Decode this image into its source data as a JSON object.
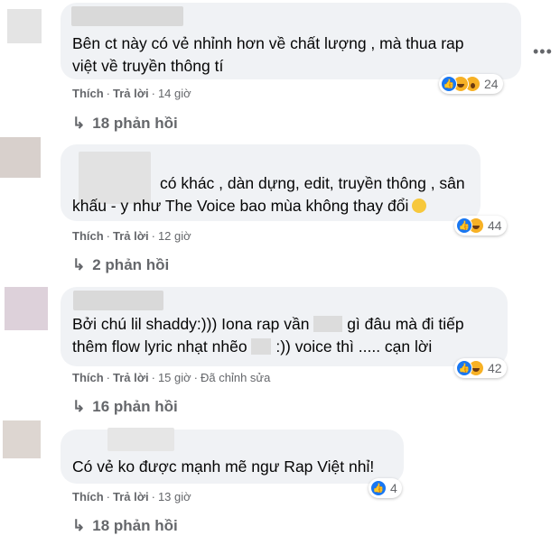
{
  "comments": [
    {
      "lines": [
        "Bên ct này có vẻ nhỉnh hơn về chất lượng , mà thua rap",
        "việt về truyền thông tí"
      ],
      "like": "Thích",
      "reply": "Trả lời",
      "time": "14 giờ",
      "edited": "",
      "reactions": [
        "like-icon",
        "haha-icon",
        "wow-icon"
      ],
      "reaction_count": "24",
      "replies": "18 phản hồi"
    },
    {
      "lines": [
        "có khác , dàn dựng, edit, truyền thông , sân",
        "khấu - y như The Voice bao mùa không thay đổi"
      ],
      "like": "Thích",
      "reply": "Trả lời",
      "time": "12 giờ",
      "edited": "",
      "reactions": [
        "like-icon",
        "haha-icon"
      ],
      "reaction_count": "44",
      "replies": "2 phản hồi"
    },
    {
      "lines": [
        "Bởi chú lil shaddy:))) Iona rap vần",
        "gì đâu mà đi tiếp",
        "thêm flow lyric nhạt nhẽo",
        ":)) voice thì ..... cạn lời"
      ],
      "like": "Thích",
      "reply": "Trả lời",
      "time": "15 giờ",
      "edited": "Đã chỉnh sửa",
      "reactions": [
        "like-icon",
        "haha-icon"
      ],
      "reaction_count": "42",
      "replies": "16 phản hồi"
    },
    {
      "lines": [
        "Có vẻ ko được mạnh mẽ ngư Rap Việt nhỉ!"
      ],
      "like": "Thích",
      "reply": "Trả lời",
      "time": "13 giờ",
      "edited": "",
      "reactions": [
        "like-icon"
      ],
      "reaction_count": "4",
      "replies": "18 phản hồi"
    }
  ],
  "more_icon": "more-horizontal-icon",
  "colors": {
    "bubble": "#f0f2f5",
    "meta": "#65676b",
    "like": "#1877f2",
    "haha": "#f7b125"
  }
}
